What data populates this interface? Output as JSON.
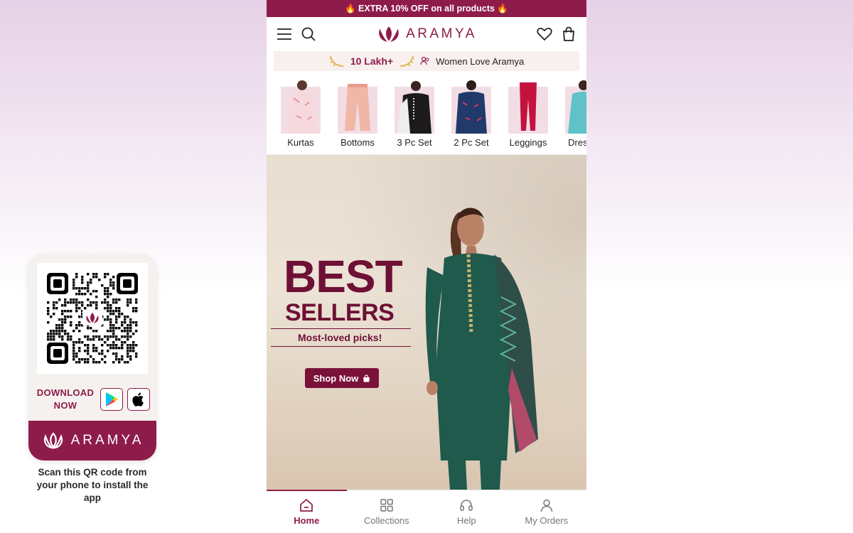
{
  "qr_card": {
    "download_label": "DOWNLOAD NOW",
    "brand": "ARAMYA",
    "caption": "Scan this QR code from your phone to install the app"
  },
  "promo": {
    "text": "🔥 EXTRA 10% OFF on all products 🔥"
  },
  "header": {
    "brand": "ARAMYA"
  },
  "trust": {
    "count": "10 Lakh+",
    "text": "Women Love Aramya"
  },
  "categories": [
    {
      "label": "Kurtas"
    },
    {
      "label": "Bottoms"
    },
    {
      "label": "3 Pc Set"
    },
    {
      "label": "2 Pc Set"
    },
    {
      "label": "Leggings"
    },
    {
      "label": "Dresses"
    }
  ],
  "banner": {
    "line1": "BEST",
    "line2": "SELLERS",
    "tagline": "Most-loved picks!",
    "cta": "Shop Now"
  },
  "bottom_nav": [
    {
      "label": "Home",
      "active": true
    },
    {
      "label": "Collections",
      "active": false
    },
    {
      "label": "Help",
      "active": false
    },
    {
      "label": "My Orders",
      "active": false
    }
  ],
  "colors": {
    "brand": "#8e1c4b",
    "banner_text": "#6e1035"
  }
}
